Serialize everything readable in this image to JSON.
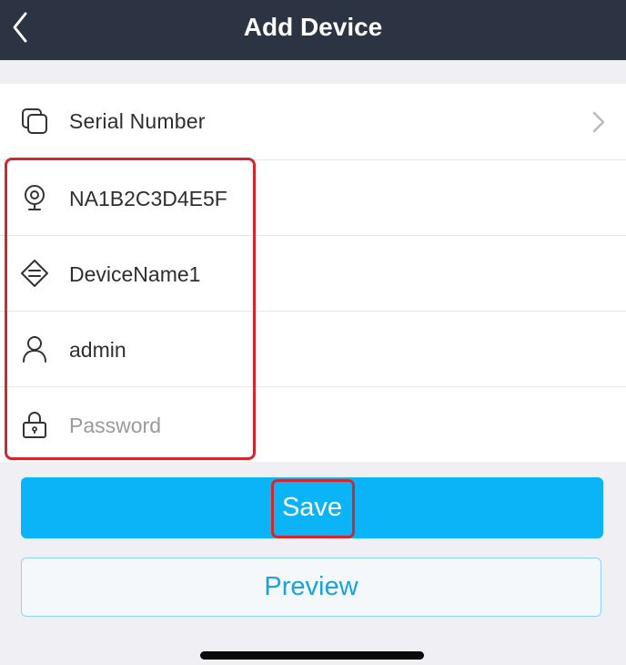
{
  "nav": {
    "title": "Add Device",
    "back_icon": "chevron-left-icon"
  },
  "form": {
    "rows": [
      {
        "icon": "serial-number-icon",
        "label": "Serial Number",
        "has_chevron": true
      },
      {
        "icon": "camera-icon",
        "value": "NA1B2C3D4E5F"
      },
      {
        "icon": "device-tag-icon",
        "value": "DeviceName1"
      },
      {
        "icon": "user-icon",
        "value": "admin"
      },
      {
        "icon": "lock-icon",
        "value": "",
        "placeholder": "Password"
      }
    ]
  },
  "buttons": {
    "save_label": "Save",
    "preview_label": "Preview"
  },
  "colors": {
    "nav_bg": "#2c3444",
    "accent": "#0bb4f7",
    "preview_text": "#18a3de",
    "highlight": "#d0282f",
    "background": "#efeff4"
  }
}
